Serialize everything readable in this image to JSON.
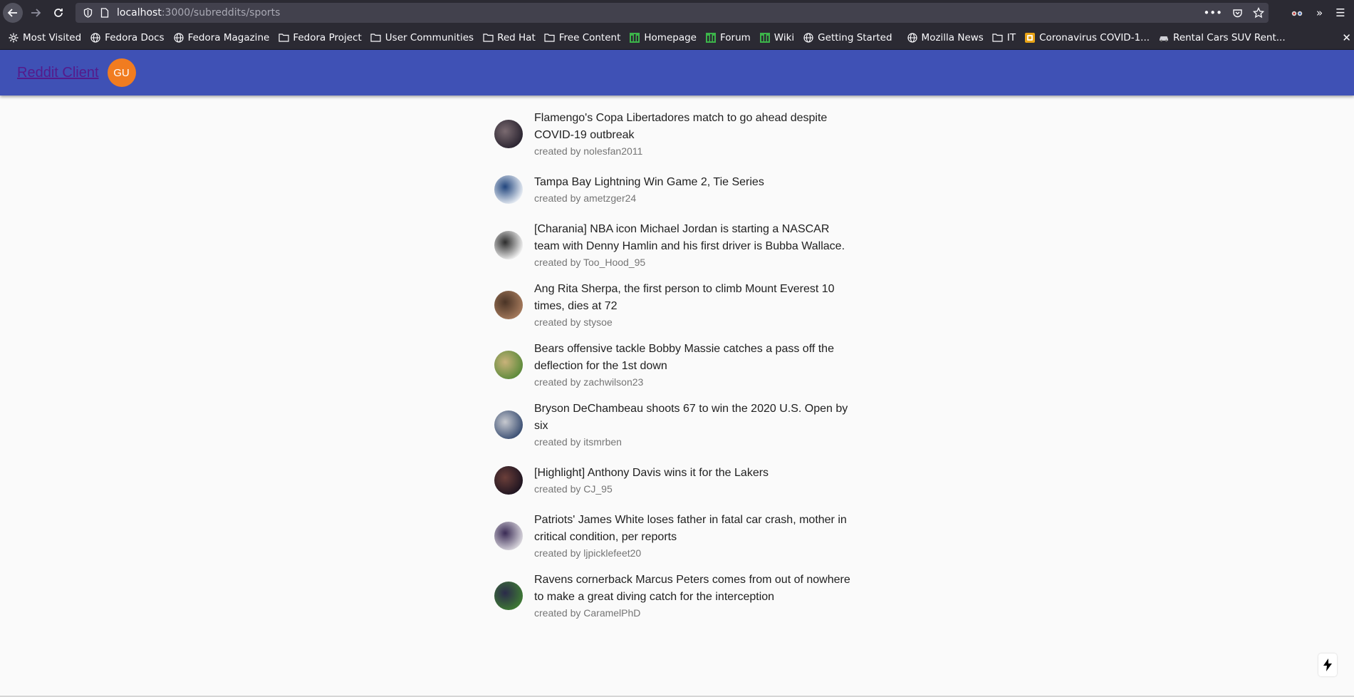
{
  "browser": {
    "url_host": "localhost",
    "url_path": ":3000/subreddits/sports",
    "bookmarks": [
      {
        "label": "Most Visited",
        "icon": "gear-icon"
      },
      {
        "label": "Fedora Docs",
        "icon": "globe-icon"
      },
      {
        "label": "Fedora Magazine",
        "icon": "globe-icon"
      },
      {
        "label": "Fedora Project",
        "icon": "folder-icon"
      },
      {
        "label": "User Communities",
        "icon": "folder-icon"
      },
      {
        "label": "Red Hat",
        "icon": "folder-icon"
      },
      {
        "label": "Free Content",
        "icon": "folder-icon"
      },
      {
        "label": "Homepage",
        "icon": "green-bars-icon"
      },
      {
        "label": "Forum",
        "icon": "green-bars-icon"
      },
      {
        "label": "Wiki",
        "icon": "green-bars-icon"
      },
      {
        "label": "Getting Started",
        "icon": "globe-icon"
      },
      {
        "label": "Mozilla News",
        "icon": "globe-icon"
      },
      {
        "label": "IT",
        "icon": "folder-icon"
      },
      {
        "label": "Coronavirus COVID-1...",
        "icon": "orange-shield-icon"
      },
      {
        "label": "Rental Cars SUV Rent...",
        "icon": "car-icon"
      }
    ]
  },
  "app": {
    "brand": "Reddit Client",
    "user_initials": "GU",
    "accent": "#3f51b5",
    "avatar_color": "#f17c20"
  },
  "posts": [
    {
      "title": "Flamengo's Copa Libertadores match to go ahead despite COVID-19 outbreak",
      "author": "created by nolesfan2011",
      "thumb": [
        "#2a2430",
        "#7a6a70"
      ]
    },
    {
      "title": "Tampa Bay Lightning Win Game 2, Tie Series",
      "author": "created by ametzger24",
      "thumb": [
        "#e8edf4",
        "#22467e"
      ]
    },
    {
      "title": "[Charania] NBA icon Michael Jordan is starting a NASCAR team with Denny Hamlin and his first driver is Bubba Wallace.",
      "author": "created by Too_Hood_95",
      "thumb": [
        "#f2f2f2",
        "#2c2c2c"
      ]
    },
    {
      "title": "Ang Rita Sherpa, the first person to climb Mount Everest 10 times, dies at 72",
      "author": "created by stysoe",
      "thumb": [
        "#a57a5c",
        "#4a3426"
      ]
    },
    {
      "title": "Bears offensive tackle Bobby Massie catches a pass off the deflection for the 1st down",
      "author": "created by zachwilson23",
      "thumb": [
        "#5c8a3a",
        "#c9b27a"
      ]
    },
    {
      "title": "Bryson DeChambeau shoots 67 to win the 2020 U.S. Open by six",
      "author": "created by itsmrben",
      "thumb": [
        "#3b4f73",
        "#c7c9cf"
      ]
    },
    {
      "title": "[Highlight] Anthony Davis wins it for the Lakers",
      "author": "created by CJ_95",
      "thumb": [
        "#1e1420",
        "#6b3f3a"
      ]
    },
    {
      "title": "Patriots' James White loses father in fatal car crash, mother in critical condition, per reports",
      "author": "created by ljpicklefeet20",
      "thumb": [
        "#d8d5dc",
        "#3a2b55"
      ]
    },
    {
      "title": "Ravens cornerback Marcus Peters comes from out of nowhere to make a great diving catch for the interception",
      "author": "created by CaramelPhD",
      "thumb": [
        "#3e7a34",
        "#2b2b4a"
      ]
    }
  ]
}
